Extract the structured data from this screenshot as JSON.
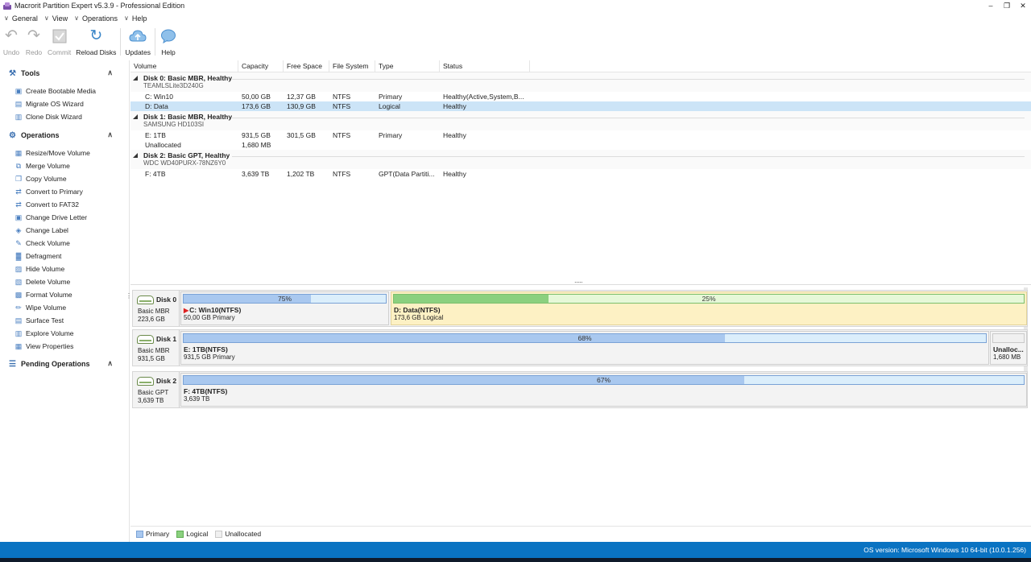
{
  "window": {
    "title": "Macrorit Partition Expert v5.3.9 - Professional Edition",
    "minimize": "–",
    "restore": "❐",
    "close": "✕"
  },
  "menu": [
    {
      "label": "General"
    },
    {
      "label": "View"
    },
    {
      "label": "Operations"
    },
    {
      "label": "Help"
    }
  ],
  "toolbar": {
    "undo": "Undo",
    "redo": "Redo",
    "commit": "Commit",
    "reload": "Reload Disks",
    "updates": "Updates",
    "help": "Help"
  },
  "sidebar": {
    "tools_title": "Tools",
    "tools": [
      {
        "label": "Create Bootable Media",
        "icon": "bootable-media-icon"
      },
      {
        "label": "Migrate OS Wizard",
        "icon": "migrate-os-icon"
      },
      {
        "label": "Clone Disk Wizard",
        "icon": "clone-disk-icon"
      }
    ],
    "operations_title": "Operations",
    "operations": [
      {
        "label": "Resize/Move Volume"
      },
      {
        "label": "Merge Volume"
      },
      {
        "label": "Copy Volume"
      },
      {
        "label": "Convert to Primary"
      },
      {
        "label": "Convert to FAT32"
      },
      {
        "label": "Change Drive Letter"
      },
      {
        "label": "Change Label"
      },
      {
        "label": "Check Volume"
      },
      {
        "label": "Defragment"
      },
      {
        "label": "Hide Volume"
      },
      {
        "label": "Delete Volume"
      },
      {
        "label": "Format Volume"
      },
      {
        "label": "Wipe Volume"
      },
      {
        "label": "Surface Test"
      },
      {
        "label": "Explore Volume"
      },
      {
        "label": "View Properties"
      }
    ],
    "pending_title": "Pending Operations"
  },
  "table": {
    "columns": [
      "Volume",
      "Capacity",
      "Free Space",
      "File System",
      "Type",
      "Status"
    ],
    "disks": [
      {
        "title": "Disk 0: Basic MBR, Healthy",
        "model": "TEAMLSLite3D240G",
        "rows": [
          {
            "volume": "C: Win10",
            "capacity": "50,00 GB",
            "free": "12,37 GB",
            "fs": "NTFS",
            "type": "Primary",
            "status": "Healthy(Active,System,B..."
          },
          {
            "volume": "D: Data",
            "capacity": "173,6 GB",
            "free": "130,9 GB",
            "fs": "NTFS",
            "type": "Logical",
            "status": "Healthy"
          }
        ]
      },
      {
        "title": "Disk 1: Basic MBR, Healthy",
        "model": "SAMSUNG HD103SI",
        "rows": [
          {
            "volume": "E: 1TB",
            "capacity": "931,5 GB",
            "free": "301,5 GB",
            "fs": "NTFS",
            "type": "Primary",
            "status": "Healthy"
          },
          {
            "volume": "Unallocated",
            "capacity": "1,680 MB",
            "free": "",
            "fs": "",
            "type": "",
            "status": ""
          }
        ]
      },
      {
        "title": "Disk 2: Basic GPT, Healthy",
        "model": "WDC WD40PURX-78NZ6Y0",
        "rows": [
          {
            "volume": "F: 4TB",
            "capacity": "3,639 TB",
            "free": "1,202 TB",
            "fs": "NTFS",
            "type": "GPT(Data Partiti...",
            "status": "Healthy"
          }
        ]
      }
    ]
  },
  "splitter_dots": ".....",
  "diskmap": [
    {
      "name": "Disk 0",
      "type": "Basic MBR",
      "size": "223,6 GB",
      "partitions": [
        {
          "pct": "75%",
          "fill": 0.63,
          "name": "C: Win10(NTFS)",
          "desc": "50,00 GB Primary",
          "kind": "primary",
          "flag": "▶"
        },
        {
          "pct": "25%",
          "fill": 0.245,
          "name": "D: Data(NTFS)",
          "desc": "173,6 GB Logical",
          "kind": "logical"
        }
      ]
    },
    {
      "name": "Disk 1",
      "type": "Basic MBR",
      "size": "931,5 GB",
      "partitions": [
        {
          "pct": "68%",
          "fill": 0.675,
          "name": "E: 1TB(NTFS)",
          "desc": "931,5 GB Primary",
          "kind": "primary"
        },
        {
          "pct": "",
          "fill": 0,
          "name": "Unalloc...",
          "desc": "1,680 MB",
          "kind": "unalloc"
        }
      ]
    },
    {
      "name": "Disk 2",
      "type": "Basic GPT",
      "size": "3,639 TB",
      "partitions": [
        {
          "pct": "67%",
          "fill": 0.667,
          "name": "F: 4TB(NTFS)",
          "desc": "3,639 TB",
          "kind": "primary"
        }
      ]
    }
  ],
  "legend": [
    {
      "label": "Primary",
      "color": "#a9c8ef",
      "border": "#7aa2d6"
    },
    {
      "label": "Logical",
      "color": "#8bd07f",
      "border": "#5fae54"
    },
    {
      "label": "Unallocated",
      "color": "#f0f0f0",
      "border": "#c9c9c9"
    }
  ],
  "status": {
    "os_version": "OS version: Microsoft Windows 10  64-bit  (10.0.1.256)"
  }
}
